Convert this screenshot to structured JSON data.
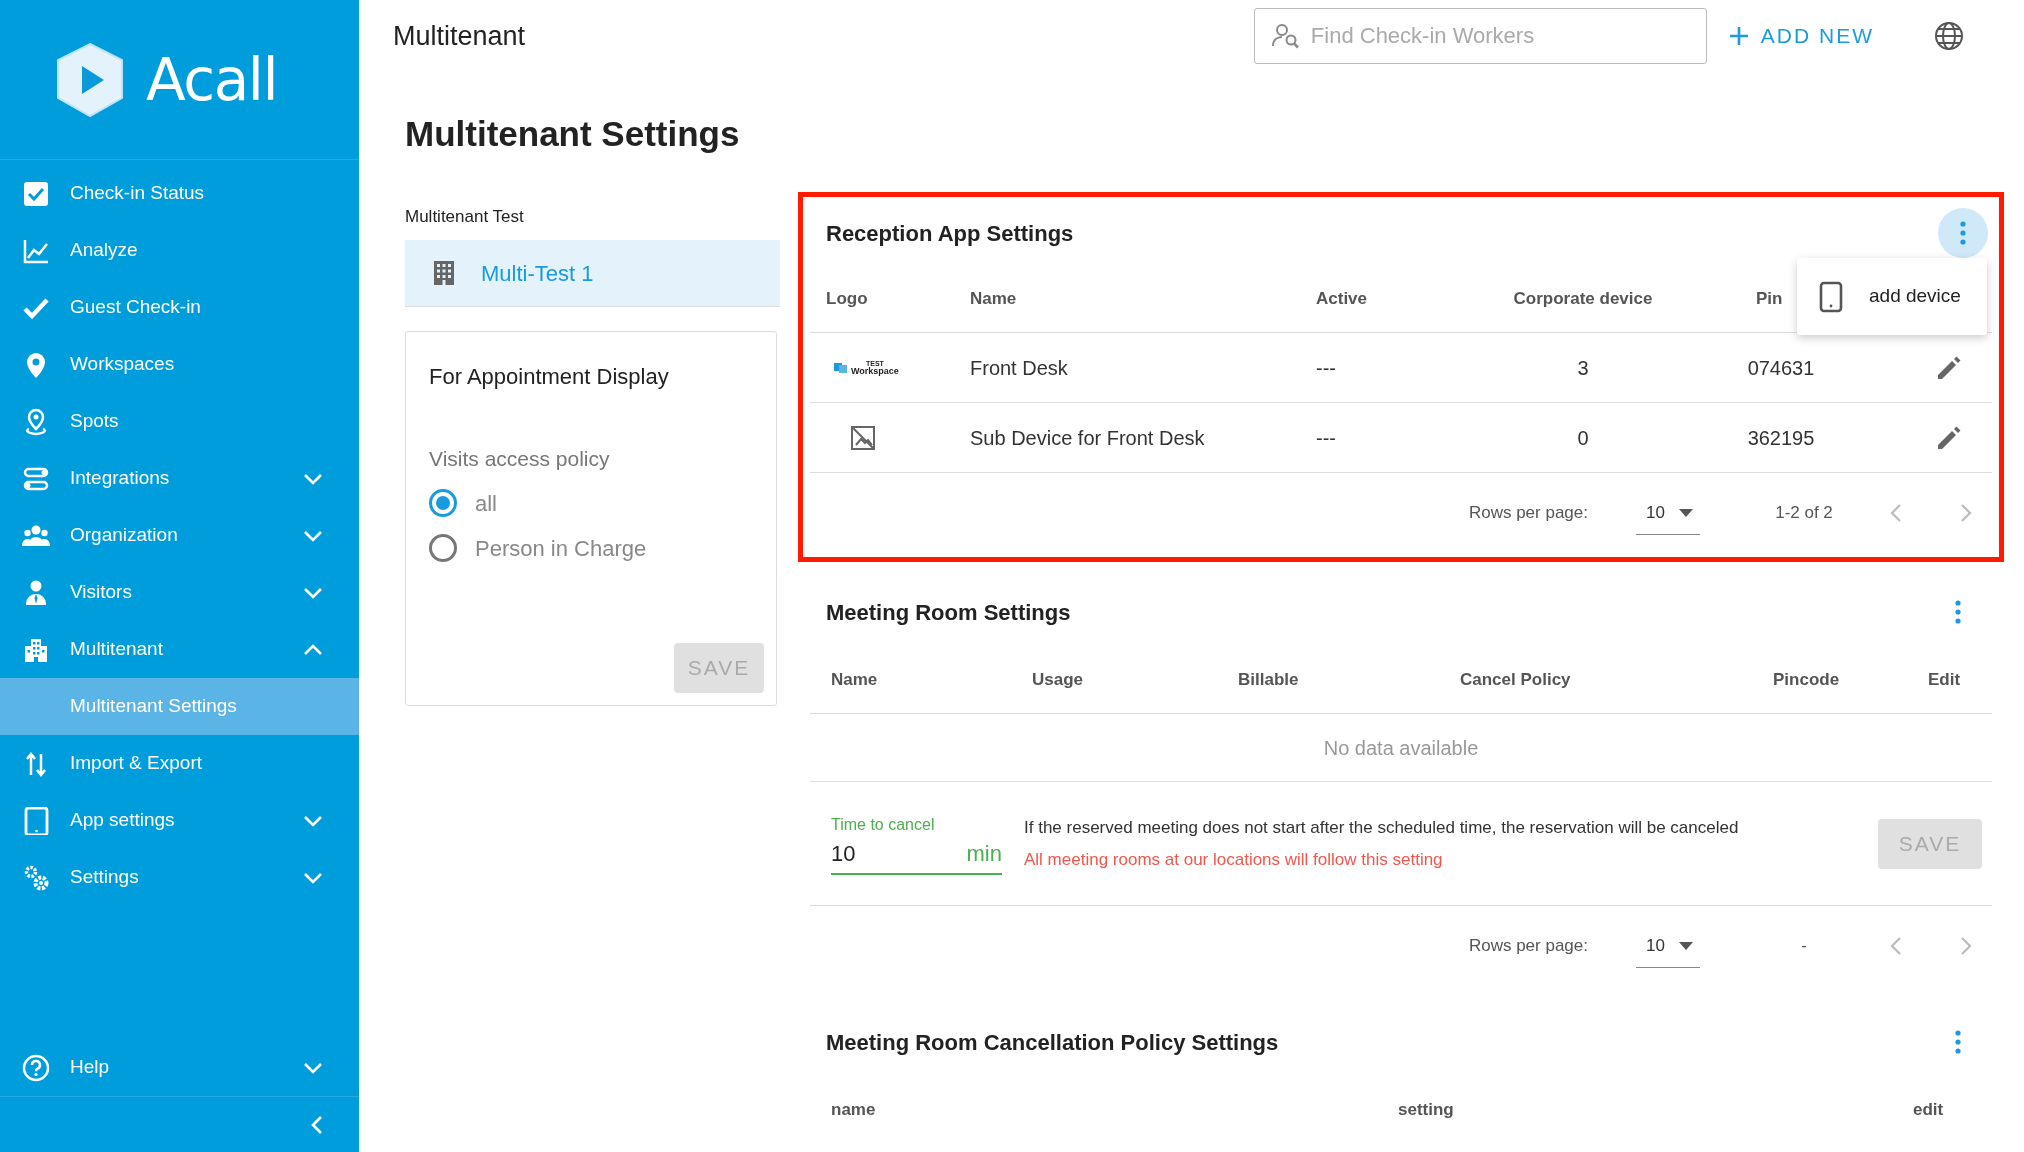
{
  "sidebar": {
    "brand": "Acall",
    "items": [
      {
        "label": "Check-in Status"
      },
      {
        "label": "Analyze"
      },
      {
        "label": "Guest Check-in"
      },
      {
        "label": "Workspaces"
      },
      {
        "label": "Spots"
      },
      {
        "label": "Integrations",
        "expanded": false
      },
      {
        "label": "Organization",
        "expanded": false
      },
      {
        "label": "Visitors",
        "expanded": false
      },
      {
        "label": "Multitenant",
        "expanded": true,
        "children": [
          {
            "label": "Multitenant Settings",
            "selected": true
          }
        ]
      },
      {
        "label": "Import & Export"
      },
      {
        "label": "App settings",
        "expanded": false
      },
      {
        "label": "Settings",
        "expanded": false
      }
    ],
    "footer_items": [
      {
        "label": "Help",
        "expanded": false
      }
    ]
  },
  "header": {
    "title": "Multitenant",
    "search": {
      "placeholder": "Find Check-in Workers"
    },
    "add_button": "ADD NEW"
  },
  "page_title": "Multitenant Settings",
  "tenant_list": {
    "heading": "Multitenant Test",
    "items": [
      {
        "label": "Multi-Test 1",
        "selected": true
      }
    ]
  },
  "display_card": {
    "title": "For Appointment Display",
    "policy_label": "Visits access policy",
    "options": [
      {
        "label": "all",
        "selected": true
      },
      {
        "label": "Person in Charge",
        "selected": false
      }
    ],
    "save": "SAVE",
    "save_disabled": true
  },
  "reception": {
    "title": "Reception App Settings",
    "highlighted": true,
    "menu_open": true,
    "menu": [
      {
        "label": "add device"
      }
    ],
    "columns": [
      "Logo",
      "Name",
      "Active",
      "Corporate device",
      "Pin"
    ],
    "rows": [
      {
        "logo": {
          "kind": "image",
          "lines": [
            "TEST",
            "Workspace"
          ]
        },
        "name": "Front Desk",
        "active": "---",
        "corporate_device": "3",
        "pincode": "074631"
      },
      {
        "logo": {
          "kind": "missing"
        },
        "name": "Sub Device for Front Desk",
        "active": "---",
        "corporate_device": "0",
        "pincode": "362195"
      }
    ],
    "pagination": {
      "label": "Rows per page:",
      "rows_per_page": "10",
      "range": "1-2 of 2"
    }
  },
  "meeting_room": {
    "title": "Meeting Room Settings",
    "columns": [
      "Name",
      "Usage",
      "Billable",
      "Cancel Policy",
      "Pincode",
      "Edit"
    ],
    "empty_text": "No data available",
    "time_to_cancel": {
      "label": "Time to cancel",
      "value": "10",
      "unit": "min"
    },
    "note": "If the reserved meeting does not start after the scheduled time, the reservation will be canceled",
    "warning": "All meeting rooms at our locations will follow this setting",
    "save": "SAVE",
    "save_disabled": true,
    "pagination": {
      "label": "Rows per page:",
      "rows_per_page": "10",
      "range": "-"
    }
  },
  "cancellation": {
    "title": "Meeting Room Cancellation Policy Settings",
    "columns": [
      "name",
      "setting",
      "edit"
    ]
  }
}
